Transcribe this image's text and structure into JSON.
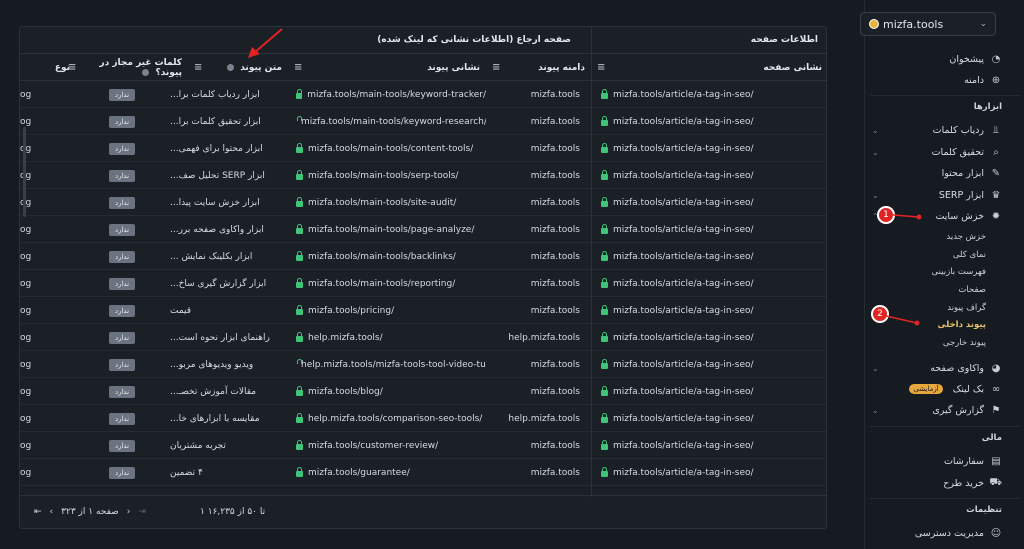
{
  "site_selector": {
    "name": "mizfa.tools"
  },
  "sidebar": {
    "top_items": [
      {
        "label": "پیشخوان",
        "icon": "dashboard-icon"
      },
      {
        "label": "دامنه",
        "icon": "globe-icon"
      }
    ],
    "tools_label": "ابزارها",
    "tool_items": [
      {
        "label": "ردیاب کلمات",
        "icon": "chart-icon"
      },
      {
        "label": "تحقیق کلمات",
        "icon": "search-icon"
      },
      {
        "label": "ابزار محتوا",
        "icon": "pen-icon"
      },
      {
        "label": "ابزار SERP",
        "icon": "trophy-icon"
      },
      {
        "label": "خزش سایت",
        "icon": "bug-icon"
      }
    ],
    "crawl_sub_items": [
      "خزش جدید",
      "نمای کلی",
      "فهرست بازبینی",
      "صفحات",
      "گراف پیوند",
      "پیوند داخلی",
      "پیوند خارجی"
    ],
    "after_items": [
      {
        "label": "واکاوی صفحه",
        "icon": "gauge-icon"
      },
      {
        "label": "بک لینک",
        "icon": "link-icon",
        "badge": "آزمایشی"
      },
      {
        "label": "گزارش گیری",
        "icon": "flag-icon"
      }
    ],
    "finance_label": "مالی",
    "finance_items": [
      {
        "label": "سفارشات",
        "icon": "clipboard-icon"
      },
      {
        "label": "خرید طرح",
        "icon": "cart-icon"
      }
    ],
    "settings_label": "تنظیمات",
    "settings_items": [
      {
        "label": "مدیریت دسترسی",
        "icon": "users-icon"
      }
    ]
  },
  "table": {
    "group_page_info": "اطلاعات صفحه",
    "group_referrer": "صفحه ارجاع (اطلاعات نشانی که لینک شده)",
    "columns": {
      "page_url": "نشانی صفحه",
      "link_domain": "دامنه پیوند",
      "link_url": "نشانی پیوند",
      "anchor_text": "متن پیوند",
      "forbidden_words": "کلمات غیر مجاز در پیوند؟",
      "type_partial": "نوع"
    },
    "rows": [
      {
        "page_url": "mizfa.tools/article/a-tag-in-seo/",
        "domain": "mizfa.tools",
        "link_url": "mizfa.tools/main-tools/keyword-tracker/",
        "anchor": "ابزار ردیاب کلمات برا...",
        "flag": "ندارد",
        "edge": "og"
      },
      {
        "page_url": "mizfa.tools/article/a-tag-in-seo/",
        "domain": "mizfa.tools",
        "link_url": "mizfa.tools/main-tools/keyword-research/",
        "anchor": "ابزار تحقیق کلمات برا...",
        "flag": "ندارد",
        "edge": "og"
      },
      {
        "page_url": "mizfa.tools/article/a-tag-in-seo/",
        "domain": "mizfa.tools",
        "link_url": "mizfa.tools/main-tools/content-tools/",
        "anchor": "ابزار محتوا برای فهمی...",
        "flag": "ندارد",
        "edge": "og"
      },
      {
        "page_url": "mizfa.tools/article/a-tag-in-seo/",
        "domain": "mizfa.tools",
        "link_url": "mizfa.tools/main-tools/serp-tools/",
        "anchor": "ابزار SERP تحلیل صف...",
        "flag": "ندارد",
        "edge": "og"
      },
      {
        "page_url": "mizfa.tools/article/a-tag-in-seo/",
        "domain": "mizfa.tools",
        "link_url": "mizfa.tools/main-tools/site-audit/",
        "anchor": "ابزار خزش سایت پیدا...",
        "flag": "ندارد",
        "edge": "og"
      },
      {
        "page_url": "mizfa.tools/article/a-tag-in-seo/",
        "domain": "mizfa.tools",
        "link_url": "mizfa.tools/main-tools/page-analyze/",
        "anchor": "ابزار واکاوی صفحه برر...",
        "flag": "ندارد",
        "edge": "og"
      },
      {
        "page_url": "mizfa.tools/article/a-tag-in-seo/",
        "domain": "mizfa.tools",
        "link_url": "mizfa.tools/main-tools/backlinks/",
        "anchor": "ابزار بکلینک نمایش ...",
        "flag": "ندارد",
        "edge": "og"
      },
      {
        "page_url": "mizfa.tools/article/a-tag-in-seo/",
        "domain": "mizfa.tools",
        "link_url": "mizfa.tools/main-tools/reporting/",
        "anchor": "ابزار گزارش گیری ساخ...",
        "flag": "ندارد",
        "edge": "og"
      },
      {
        "page_url": "mizfa.tools/article/a-tag-in-seo/",
        "domain": "mizfa.tools",
        "link_url": "mizfa.tools/pricing/",
        "anchor": "قیمت",
        "flag": "ندارد",
        "edge": "og"
      },
      {
        "page_url": "mizfa.tools/article/a-tag-in-seo/",
        "domain": "help.mizfa.tools",
        "link_url": "help.mizfa.tools/",
        "anchor": "راهنمای ابزار نحوه است...",
        "flag": "ندارد",
        "edge": "og"
      },
      {
        "page_url": "mizfa.tools/article/a-tag-in-seo/",
        "domain": "mizfa.tools",
        "link_url": "help.mizfa.tools/mizfa-tools-tool-video-tutorial",
        "anchor": "ویدیو ویدیوهای مربو...",
        "flag": "ندارد",
        "edge": "og"
      },
      {
        "page_url": "mizfa.tools/article/a-tag-in-seo/",
        "domain": "mizfa.tools",
        "link_url": "mizfa.tools/blog/",
        "anchor": "مقالات آموزش تخصـ...",
        "flag": "ندارد",
        "edge": "og"
      },
      {
        "page_url": "mizfa.tools/article/a-tag-in-seo/",
        "domain": "help.mizfa.tools",
        "link_url": "help.mizfa.tools/comparison-seo-tools/",
        "anchor": "مقایسه با ابزارهای خا...",
        "flag": "ندارد",
        "edge": "og"
      },
      {
        "page_url": "mizfa.tools/article/a-tag-in-seo/",
        "domain": "mizfa.tools",
        "link_url": "mizfa.tools/customer-review/",
        "anchor": "تجربه مشتریان",
        "flag": "ندارد",
        "edge": "og"
      },
      {
        "page_url": "mizfa.tools/article/a-tag-in-seo/",
        "domain": "mizfa.tools",
        "link_url": "mizfa.tools/guarantee/",
        "anchor": "۴ تضمین",
        "flag": "ندارد",
        "edge": "og"
      }
    ],
    "footer": {
      "range": "۱ تا ۵۰ از ۱۶,۲۳۵",
      "page": "صفحه ۱ از ۳۲۳"
    }
  },
  "annotations": {
    "marker1": "1",
    "marker2": "2",
    "accent": "#e02424"
  }
}
